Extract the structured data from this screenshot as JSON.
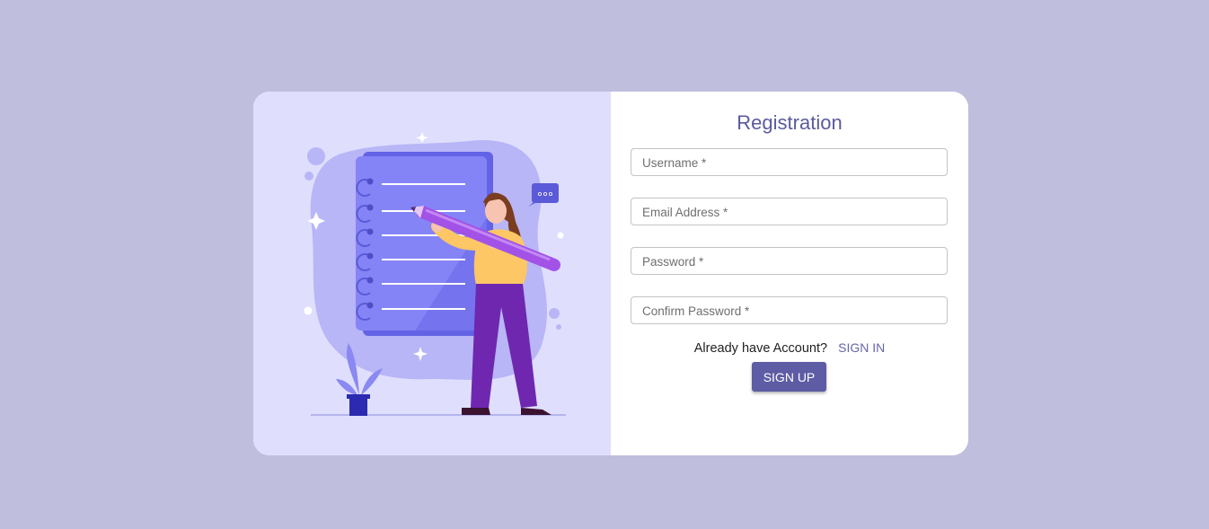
{
  "form": {
    "title": "Registration",
    "fields": [
      {
        "placeholder": "Username *"
      },
      {
        "placeholder": "Email Address *"
      },
      {
        "placeholder": "Password *"
      },
      {
        "placeholder": "Confirm Password *"
      }
    ],
    "account_prompt": "Already have Account?",
    "sign_in_label": "SIGN IN",
    "sign_up_label": "SIGN UP"
  },
  "illustration": {
    "name": "woman-with-pencil-and-notebook"
  },
  "colors": {
    "page_background": "#bfbedd",
    "illustration_background": "#dfdefd",
    "accent": "#5e5ca4",
    "title": "#5b5a9e"
  }
}
